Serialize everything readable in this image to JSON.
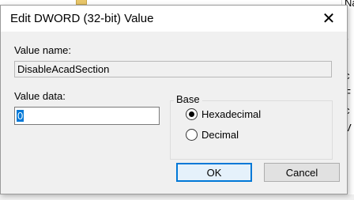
{
  "window": {
    "title": "Edit DWORD (32-bit) Value",
    "close_glyph": "✕"
  },
  "value_name": {
    "label": "Value name:",
    "value": "DisableAcadSection"
  },
  "value_data": {
    "label": "Value data:",
    "value": "0"
  },
  "base": {
    "legend": "Base",
    "options": [
      {
        "label": "Hexadecimal",
        "checked": true
      },
      {
        "label": "Decimal",
        "checked": false
      }
    ]
  },
  "buttons": {
    "ok": "OK",
    "cancel": "Cancel"
  },
  "background": {
    "right_column_fragments": [
      "Nam",
      "r",
      "i",
      "c",
      "F",
      "c",
      "V"
    ]
  },
  "colors": {
    "selection": "#0078d7",
    "dialog_bg": "#f0f0f0"
  }
}
